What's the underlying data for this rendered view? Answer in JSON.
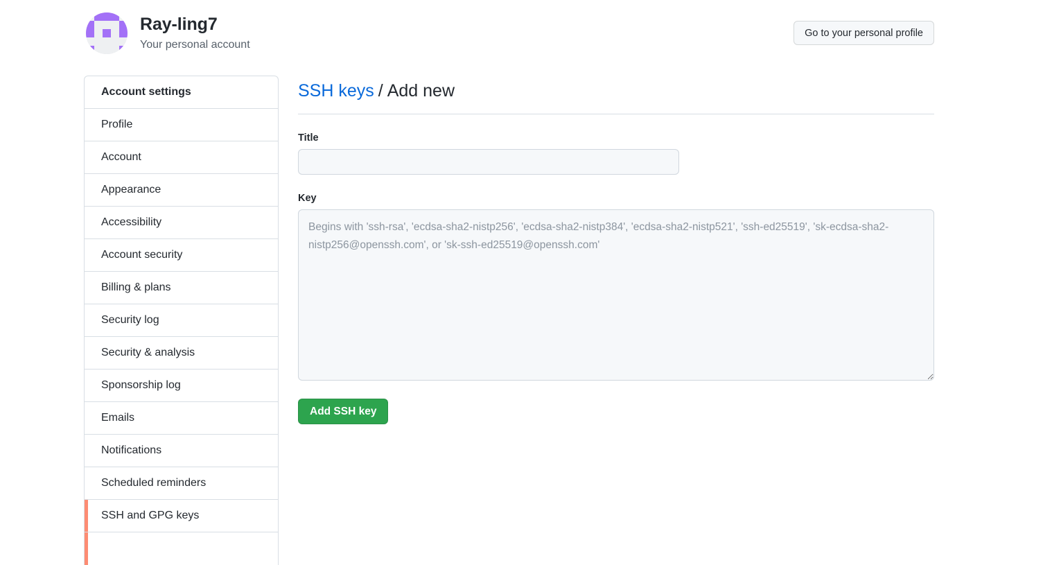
{
  "header": {
    "account_name": "Ray-ling7",
    "account_subtitle": "Your personal account",
    "profile_button_label": "Go to your personal profile",
    "avatar_icon": "identicon-avatar",
    "avatar_color": "#a371f7",
    "avatar_background": "#eef0f2"
  },
  "sidebar": {
    "title": "Account settings",
    "active_index": 12,
    "accent_color": "#fd8c73",
    "items": [
      {
        "label": "Profile"
      },
      {
        "label": "Account"
      },
      {
        "label": "Appearance"
      },
      {
        "label": "Accessibility"
      },
      {
        "label": "Account security"
      },
      {
        "label": "Billing & plans"
      },
      {
        "label": "Security log"
      },
      {
        "label": "Security & analysis"
      },
      {
        "label": "Sponsorship log"
      },
      {
        "label": "Emails"
      },
      {
        "label": "Notifications"
      },
      {
        "label": "Scheduled reminders"
      },
      {
        "label": "SSH and GPG keys"
      }
    ]
  },
  "main": {
    "breadcrumb_link": "SSH keys",
    "breadcrumb_separator": "/",
    "breadcrumb_current": "Add new",
    "title_label": "Title",
    "title_value": "",
    "title_placeholder": "",
    "key_label": "Key",
    "key_value": "",
    "key_placeholder": "Begins with 'ssh-rsa', 'ecdsa-sha2-nistp256', 'ecdsa-sha2-nistp384', 'ecdsa-sha2-nistp521', 'ssh-ed25519', 'sk-ecdsa-sha2-nistp256@openssh.com', or 'sk-ssh-ed25519@openssh.com'",
    "submit_label": "Add SSH key",
    "submit_color": "#2da44e",
    "link_color": "#0969da"
  }
}
